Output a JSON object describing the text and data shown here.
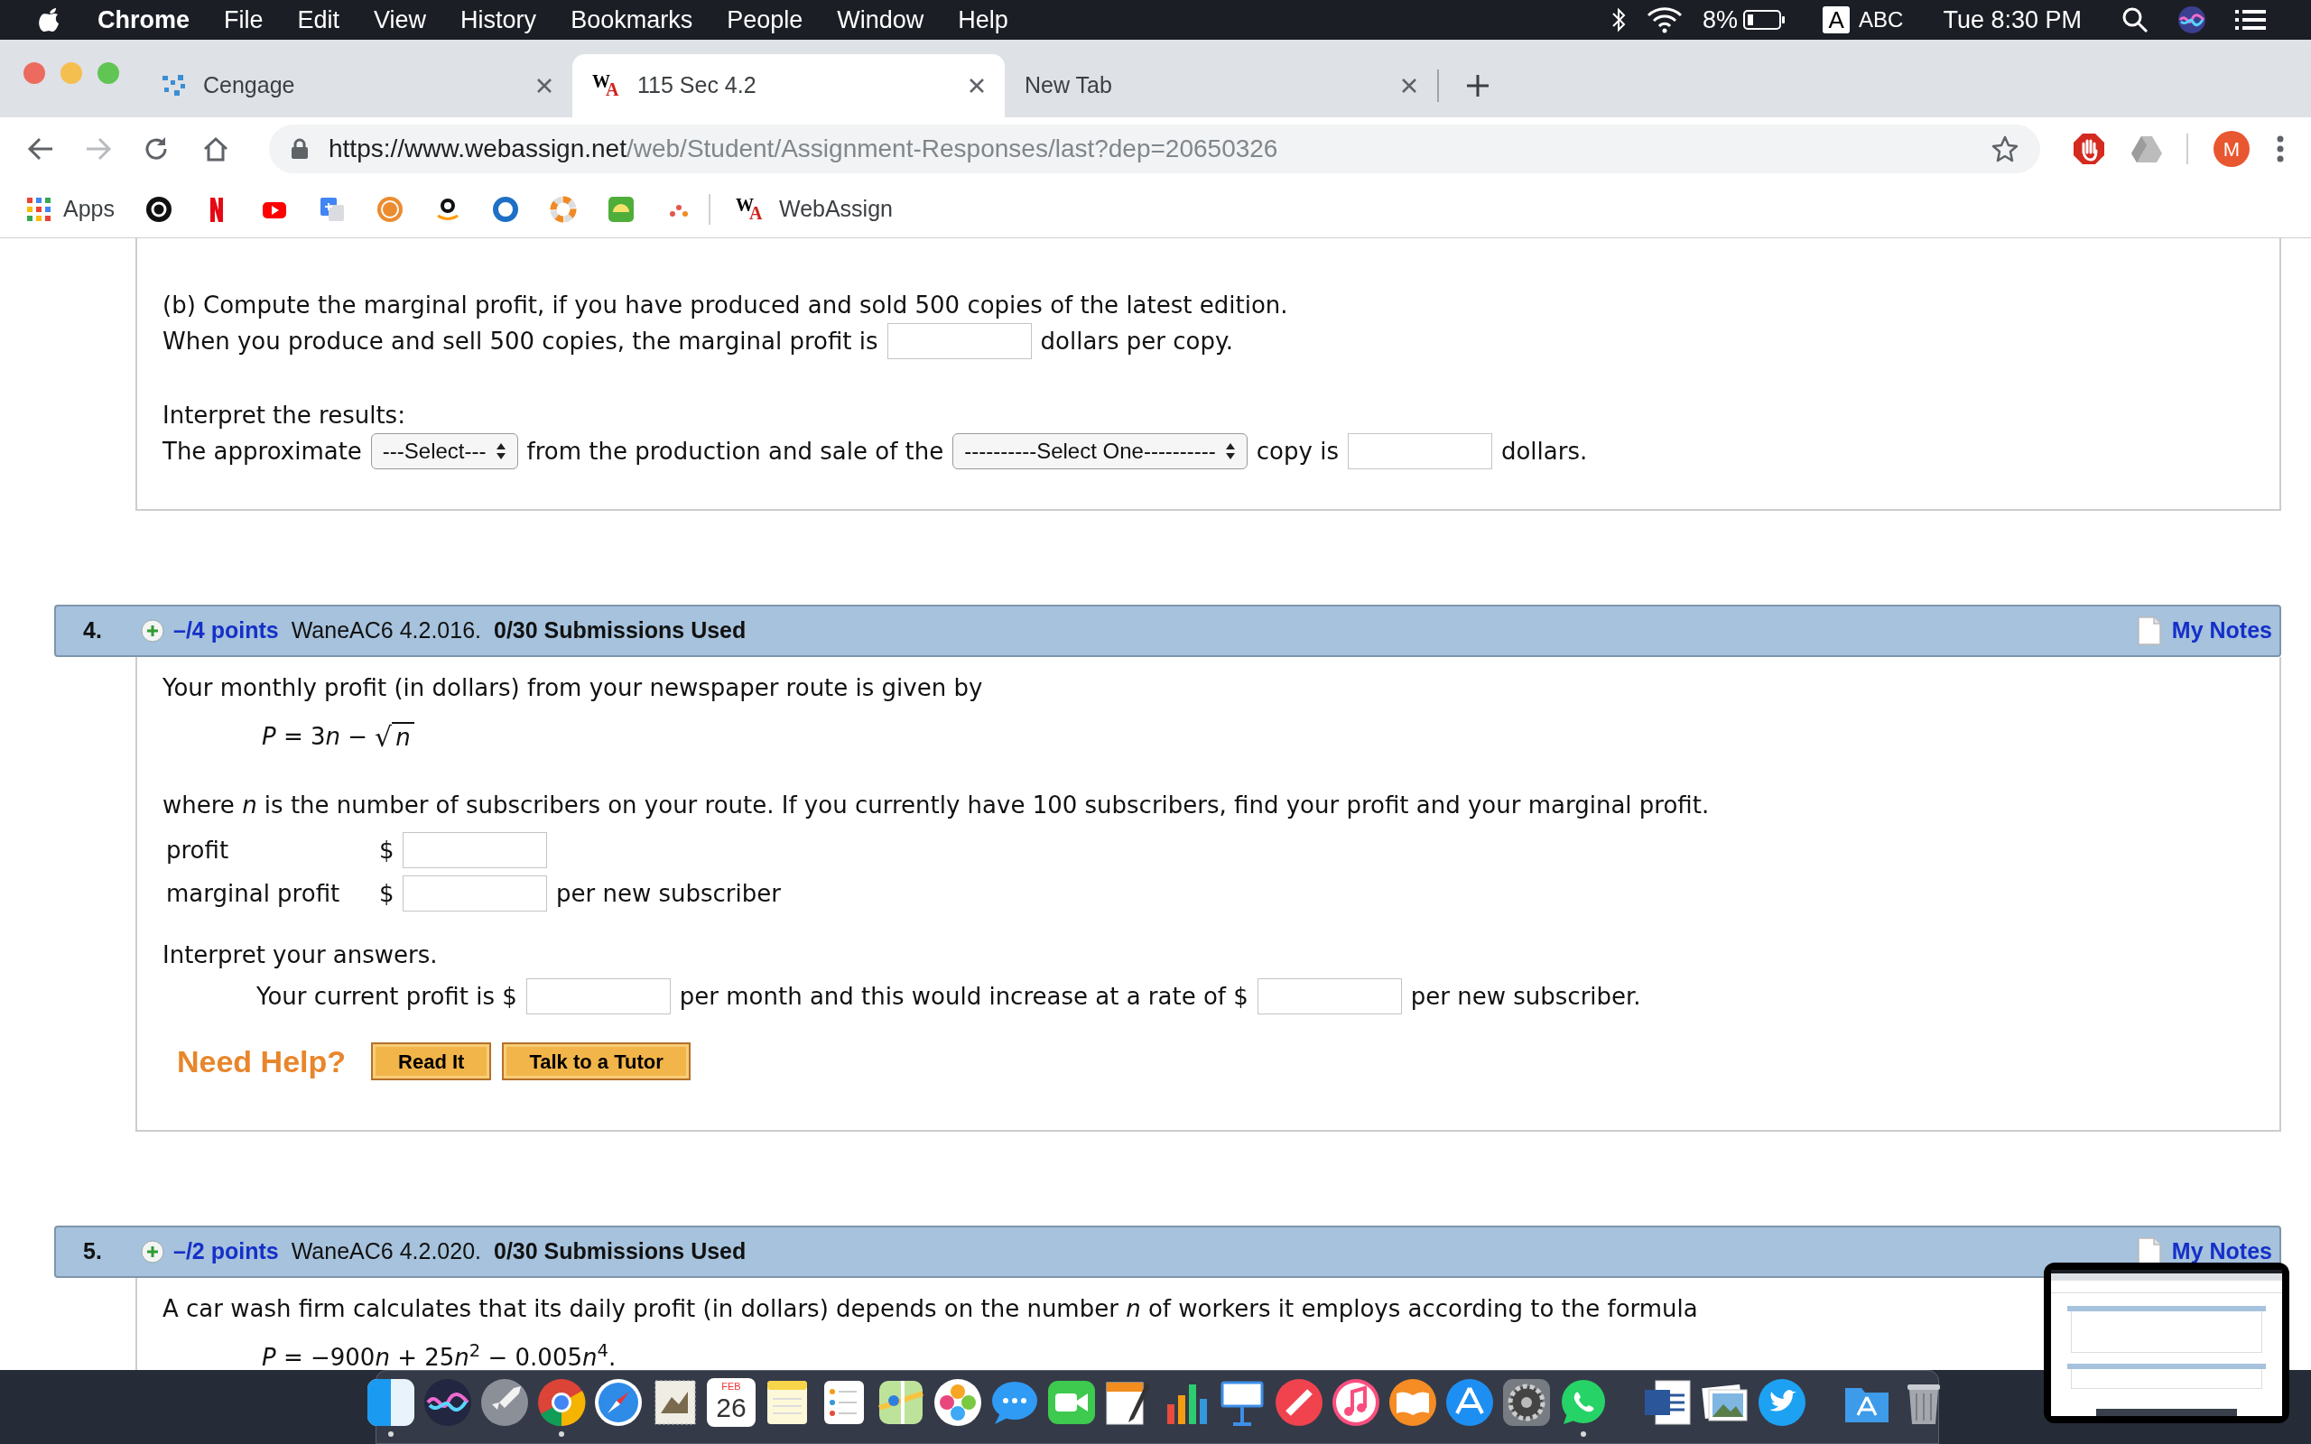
{
  "menu_bar": {
    "app": "Chrome",
    "menus": [
      "File",
      "Edit",
      "View",
      "History",
      "Bookmarks",
      "People",
      "Window",
      "Help"
    ],
    "battery": "8%",
    "input_source_letter": "A",
    "input_source": "ABC",
    "clock": "Tue 8:30 PM"
  },
  "tabs": [
    {
      "title": "Cengage",
      "kind": "cengage",
      "selected": false
    },
    {
      "title": "115 Sec 4.2",
      "kind": "webassign",
      "logo_letters": [
        "W",
        "A"
      ],
      "selected": true
    },
    {
      "title": "New Tab",
      "kind": "blank",
      "selected": false
    }
  ],
  "address_bar": {
    "host": "https://www.webassign.net",
    "path": "/web/Student/Assignment-Responses/last?dep=20650326"
  },
  "profile_initial": "M",
  "bookmarks": [
    {
      "kind": "apps",
      "label": "Apps"
    },
    {
      "kind": "record"
    },
    {
      "kind": "netflix"
    },
    {
      "kind": "video"
    },
    {
      "kind": "translate"
    },
    {
      "kind": "coin"
    },
    {
      "kind": "smile"
    },
    {
      "kind": "ring"
    },
    {
      "kind": "lifebuoy"
    },
    {
      "kind": "sun"
    },
    {
      "kind": "dots"
    },
    {
      "kind": "webassign",
      "logo_letters": [
        "W",
        "A"
      ],
      "label": "WebAssign"
    }
  ],
  "previous_question": {
    "paragraphs": [
      [
        {
          "kind": "line",
          "segments": [
            {
              "kind": "text",
              "text": "(b) Compute the marginal profit, if you have produced and sold 500 copies of the latest edition."
            }
          ]
        },
        {
          "kind": "line",
          "segments": [
            {
              "kind": "text",
              "text": "When you produce and sell 500 copies, the marginal profit is"
            },
            {
              "kind": "input"
            },
            {
              "kind": "text",
              "text": "dollars per copy."
            }
          ]
        }
      ],
      [
        {
          "kind": "line",
          "segments": [
            {
              "kind": "text",
              "text": "Interpret the results:"
            }
          ]
        },
        {
          "kind": "line",
          "segments": [
            {
              "kind": "text",
              "text": "The approximate"
            },
            {
              "kind": "select",
              "text": "---Select---"
            },
            {
              "kind": "text",
              "text": "from the production and sale of the"
            },
            {
              "kind": "select",
              "text": "----------Select One----------"
            },
            {
              "kind": "text",
              "text": "copy is"
            },
            {
              "kind": "input"
            },
            {
              "kind": "text",
              "text": "dollars."
            }
          ]
        }
      ]
    ]
  },
  "questions": [
    {
      "number": "4.",
      "points": "–/4 points",
      "source": "WaneAC6 4.2.016.",
      "submissions": "0/30 Submissions Used",
      "notes": "My Notes",
      "paragraphs": [
        [
          {
            "kind": "line",
            "segments": [
              {
                "kind": "text",
                "text": "Your monthly profit (in dollars) from your newspaper route is given by"
              }
            ]
          },
          {
            "kind": "formula",
            "parts": [
              {
                "kind": "var",
                "text": "P"
              },
              {
                "kind": "plain",
                "text": " = 3"
              },
              {
                "kind": "var",
                "text": "n"
              },
              {
                "kind": "plain",
                "text": " −"
              }
            ],
            "radical": "√",
            "radicand": "n"
          }
        ],
        [
          {
            "kind": "line",
            "segments": [
              {
                "kind": "text",
                "text": "where *n* is the number of subscribers on your route. If you currently have 100 subscribers, find your profit and your marginal profit."
              }
            ]
          },
          {
            "kind": "answer-rows",
            "rows": [
              {
                "label": "profit",
                "prefix": "$"
              },
              {
                "label": "marginal profit",
                "prefix": "$",
                "suffix": "per new subscriber"
              }
            ]
          }
        ],
        [
          {
            "kind": "line",
            "segments": [
              {
                "kind": "text",
                "text": "Interpret your answers."
              }
            ]
          },
          {
            "kind": "indented-line",
            "segments": [
              {
                "kind": "text",
                "text": "Your current profit is $"
              },
              {
                "kind": "input"
              },
              {
                "kind": "text",
                "text": "per month and this would increase at a rate of $"
              },
              {
                "kind": "input"
              },
              {
                "kind": "text",
                "text": "per new subscriber."
              }
            ]
          }
        ],
        [
          {
            "kind": "help",
            "label": "Need Help?",
            "buttons": [
              "Read It",
              "Talk to a Tutor"
            ]
          }
        ]
      ]
    },
    {
      "number": "5.",
      "points": "–/2 points",
      "source": "WaneAC6 4.2.020.",
      "submissions": "0/30 Submissions Used",
      "notes": "My Notes",
      "paragraphs": [
        [
          {
            "kind": "line",
            "segments": [
              {
                "kind": "text",
                "text": "A car wash firm calculates that its daily profit (in dollars) depends on the number *n* of workers it employs according to the formula"
              }
            ]
          },
          {
            "kind": "formula",
            "parts": [
              {
                "kind": "var",
                "text": "P"
              },
              {
                "kind": "plain",
                "text": " = −900"
              },
              {
                "kind": "var",
                "text": "n"
              },
              {
                "kind": "plain",
                "text": " + 25"
              },
              {
                "kind": "var",
                "text": "n"
              },
              {
                "kind": "sup",
                "text": "2"
              },
              {
                "kind": "plain",
                "text": " − 0.005"
              },
              {
                "kind": "var",
                "text": "n"
              },
              {
                "kind": "sup",
                "text": "4"
              },
              {
                "kind": "plain",
                "text": "."
              }
            ]
          }
        ]
      ]
    }
  ],
  "dock": {
    "calendar_month": "FEB",
    "calendar_day": "26",
    "items": [
      {
        "kind": "finder",
        "running": true
      },
      {
        "kind": "orb",
        "running": false
      },
      {
        "kind": "rocket",
        "running": false
      },
      {
        "kind": "chrome",
        "running": true
      },
      {
        "kind": "compass",
        "running": false
      },
      {
        "kind": "stamp",
        "running": false
      },
      {
        "kind": "calendar",
        "running": false
      },
      {
        "kind": "notepad",
        "running": false
      },
      {
        "kind": "list",
        "running": false
      },
      {
        "kind": "map",
        "running": false
      },
      {
        "kind": "flower",
        "running": false
      },
      {
        "kind": "bubble",
        "running": false
      },
      {
        "kind": "camera",
        "running": false
      },
      {
        "kind": "pen",
        "running": false
      },
      {
        "kind": "bars",
        "running": false
      },
      {
        "kind": "podium",
        "running": false
      },
      {
        "kind": "stripe",
        "running": false
      },
      {
        "kind": "note",
        "running": false
      },
      {
        "kind": "book",
        "running": false
      },
      {
        "kind": "tools",
        "running": false
      },
      {
        "kind": "gear",
        "running": false
      },
      {
        "kind": "phone",
        "running": true
      },
      {
        "kind": "divider"
      },
      {
        "kind": "document",
        "running": false
      },
      {
        "kind": "photos",
        "running": false
      },
      {
        "kind": "bird",
        "running": false
      },
      {
        "kind": "divider"
      },
      {
        "kind": "folder",
        "running": false
      },
      {
        "kind": "trash",
        "running": false
      }
    ]
  }
}
